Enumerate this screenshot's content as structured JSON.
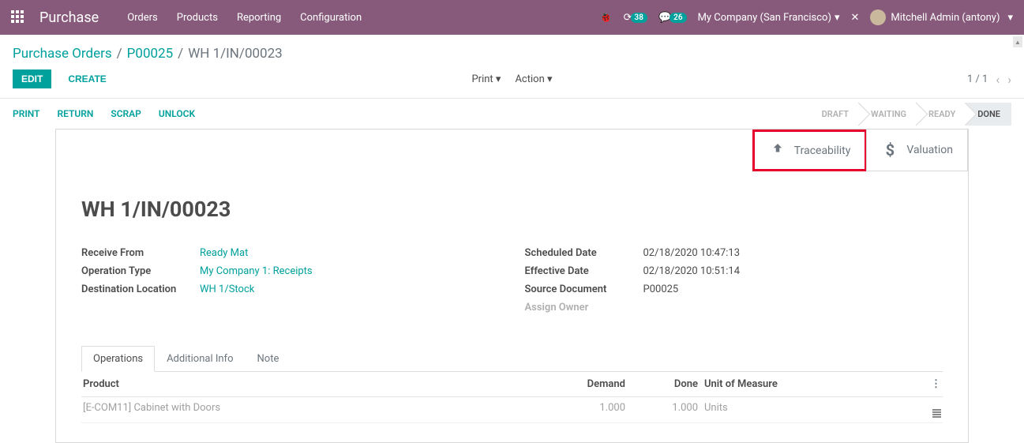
{
  "topbar": {
    "brand": "Purchase",
    "menu": [
      "Orders",
      "Products",
      "Reporting",
      "Configuration"
    ],
    "badge1": "38",
    "badge2": "26",
    "company": "My Company (San Francisco)",
    "user": "Mitchell Admin (antony)"
  },
  "breadcrumb": {
    "a": "Purchase Orders",
    "b": "P00025",
    "c": "WH 1/IN/00023"
  },
  "buttons": {
    "edit": "EDIT",
    "create": "CREATE",
    "print": "Print",
    "action": "Action"
  },
  "pager": {
    "text": "1 / 1"
  },
  "statusbar": {
    "actions": [
      "PRINT",
      "RETURN",
      "SCRAP",
      "UNLOCK"
    ],
    "stages": [
      "DRAFT",
      "WAITING",
      "READY",
      "DONE"
    ]
  },
  "statbtns": {
    "trace": "Traceability",
    "val": "Valuation"
  },
  "record": {
    "title": "WH 1/IN/00023",
    "left": {
      "l1": "Receive From",
      "v1": "Ready Mat",
      "l2": "Operation Type",
      "v2": "My Company 1: Receipts",
      "l3": "Destination Location",
      "v3": "WH 1/Stock"
    },
    "right": {
      "l1": "Scheduled Date",
      "v1": "02/18/2020 10:47:13",
      "l2": "Effective Date",
      "v2": "02/18/2020 10:51:14",
      "l3": "Source Document",
      "v3": "P00025",
      "l4": "Assign Owner"
    }
  },
  "tabs": {
    "t1": "Operations",
    "t2": "Additional Info",
    "t3": "Note"
  },
  "table": {
    "h_product": "Product",
    "h_demand": "Demand",
    "h_done": "Done",
    "h_uom": "Unit of Measure",
    "r1_product": "[E-COM11] Cabinet with Doors",
    "r1_demand": "1.000",
    "r1_done": "1.000",
    "r1_uom": "Units"
  }
}
